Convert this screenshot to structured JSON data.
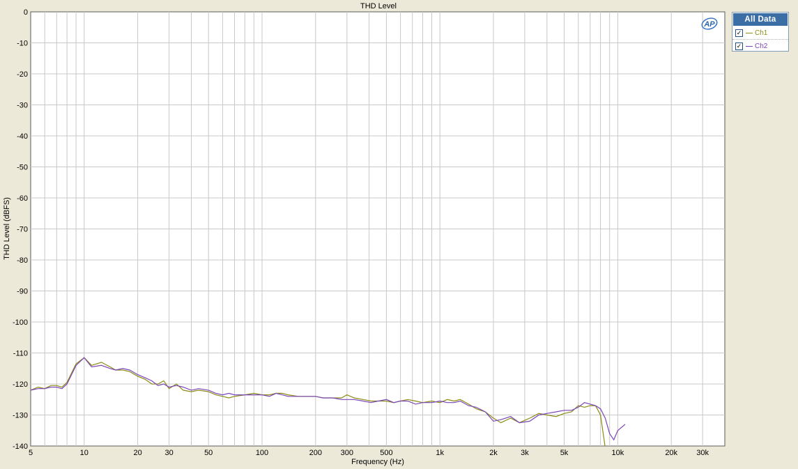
{
  "chart_data": {
    "type": "line",
    "title": "THD Level",
    "xlabel": "Frequency (Hz)",
    "ylabel": "THD Level (dBFS)",
    "x_scale": "log",
    "xlim": [
      5,
      40000
    ],
    "ylim": [
      -140,
      0
    ],
    "x_ticks": [
      5,
      10,
      20,
      30,
      50,
      100,
      200,
      300,
      500,
      1000,
      2000,
      3000,
      5000,
      10000,
      20000,
      30000
    ],
    "x_tick_labels": [
      "5",
      "10",
      "20",
      "30",
      "50",
      "100",
      "200",
      "300",
      "500",
      "1k",
      "2k",
      "3k",
      "5k",
      "10k",
      "20k",
      "30k"
    ],
    "y_ticks": [
      0,
      -10,
      -20,
      -30,
      -40,
      -50,
      -60,
      -70,
      -80,
      -90,
      -100,
      -110,
      -120,
      -130,
      -140
    ],
    "grid": true,
    "legend_placement": "right",
    "series": [
      {
        "name": "Ch1",
        "color": "#8b8b14",
        "points": [
          [
            5,
            -122
          ],
          [
            5.5,
            -121
          ],
          [
            6,
            -121.5
          ],
          [
            6.5,
            -120.5
          ],
          [
            7,
            -120.5
          ],
          [
            7.5,
            -121
          ],
          [
            8,
            -119.5
          ],
          [
            9,
            -113.5
          ],
          [
            10,
            -111.5
          ],
          [
            11,
            -114
          ],
          [
            12.5,
            -113
          ],
          [
            14,
            -114.5
          ],
          [
            15,
            -115.5
          ],
          [
            16.5,
            -115.5
          ],
          [
            18,
            -116
          ],
          [
            20,
            -117.5
          ],
          [
            22,
            -118.5
          ],
          [
            24,
            -120
          ],
          [
            26,
            -120
          ],
          [
            28,
            -119
          ],
          [
            30,
            -121.5
          ],
          [
            33,
            -120
          ],
          [
            36,
            -122
          ],
          [
            40,
            -122.5
          ],
          [
            44,
            -122
          ],
          [
            50,
            -122.5
          ],
          [
            55,
            -123.5
          ],
          [
            60,
            -124
          ],
          [
            65,
            -124.5
          ],
          [
            70,
            -124
          ],
          [
            80,
            -123.5
          ],
          [
            90,
            -123
          ],
          [
            100,
            -123.5
          ],
          [
            110,
            -123.5
          ],
          [
            120,
            -123
          ],
          [
            130,
            -123
          ],
          [
            140,
            -123.5
          ],
          [
            160,
            -124
          ],
          [
            180,
            -124
          ],
          [
            200,
            -124
          ],
          [
            220,
            -124.5
          ],
          [
            250,
            -124.5
          ],
          [
            280,
            -124.5
          ],
          [
            300,
            -123.5
          ],
          [
            330,
            -124.5
          ],
          [
            370,
            -125
          ],
          [
            410,
            -125.5
          ],
          [
            450,
            -125.5
          ],
          [
            500,
            -125.5
          ],
          [
            550,
            -126
          ],
          [
            600,
            -125.5
          ],
          [
            660,
            -125
          ],
          [
            730,
            -125.5
          ],
          [
            800,
            -126
          ],
          [
            900,
            -125.5
          ],
          [
            1000,
            -126
          ],
          [
            1100,
            -125
          ],
          [
            1200,
            -125.5
          ],
          [
            1300,
            -125
          ],
          [
            1450,
            -126.5
          ],
          [
            1600,
            -128
          ],
          [
            1800,
            -129
          ],
          [
            2000,
            -131
          ],
          [
            2200,
            -132.5
          ],
          [
            2500,
            -131
          ],
          [
            2800,
            -132.5
          ],
          [
            3200,
            -131
          ],
          [
            3600,
            -129.5
          ],
          [
            4000,
            -130
          ],
          [
            4500,
            -130.5
          ],
          [
            5000,
            -129.5
          ],
          [
            5500,
            -129
          ],
          [
            6000,
            -127
          ],
          [
            6500,
            -127.5
          ],
          [
            7000,
            -127
          ],
          [
            7500,
            -127
          ],
          [
            8000,
            -130
          ],
          [
            8500,
            -140.5
          ]
        ]
      },
      {
        "name": "Ch2",
        "color": "#7b46b8",
        "points": [
          [
            5,
            -122
          ],
          [
            5.5,
            -121.5
          ],
          [
            6,
            -121.5
          ],
          [
            6.5,
            -121
          ],
          [
            7,
            -121
          ],
          [
            7.5,
            -121.5
          ],
          [
            8,
            -120
          ],
          [
            9,
            -114
          ],
          [
            10,
            -111.5
          ],
          [
            11,
            -114.5
          ],
          [
            12.5,
            -114
          ],
          [
            14,
            -115
          ],
          [
            15,
            -115.5
          ],
          [
            16.5,
            -115
          ],
          [
            18,
            -115.5
          ],
          [
            20,
            -117
          ],
          [
            22,
            -118
          ],
          [
            24,
            -119
          ],
          [
            26,
            -120.5
          ],
          [
            28,
            -120
          ],
          [
            30,
            -121
          ],
          [
            33,
            -120.5
          ],
          [
            36,
            -121
          ],
          [
            40,
            -122
          ],
          [
            44,
            -121.5
          ],
          [
            50,
            -122
          ],
          [
            55,
            -123
          ],
          [
            60,
            -123.5
          ],
          [
            65,
            -123
          ],
          [
            70,
            -123.5
          ],
          [
            80,
            -123.5
          ],
          [
            90,
            -123.5
          ],
          [
            100,
            -123.5
          ],
          [
            110,
            -124
          ],
          [
            120,
            -123
          ],
          [
            130,
            -123.5
          ],
          [
            140,
            -124
          ],
          [
            160,
            -124
          ],
          [
            180,
            -124
          ],
          [
            200,
            -124
          ],
          [
            220,
            -124.5
          ],
          [
            250,
            -124.5
          ],
          [
            280,
            -125
          ],
          [
            300,
            -125
          ],
          [
            330,
            -125
          ],
          [
            370,
            -125.5
          ],
          [
            410,
            -126
          ],
          [
            450,
            -125.5
          ],
          [
            500,
            -125
          ],
          [
            550,
            -126
          ],
          [
            600,
            -125.5
          ],
          [
            660,
            -125.5
          ],
          [
            730,
            -126.5
          ],
          [
            800,
            -126
          ],
          [
            900,
            -126
          ],
          [
            1000,
            -125.5
          ],
          [
            1100,
            -126
          ],
          [
            1200,
            -126
          ],
          [
            1300,
            -125.5
          ],
          [
            1450,
            -127
          ],
          [
            1600,
            -127.5
          ],
          [
            1800,
            -129
          ],
          [
            2000,
            -132
          ],
          [
            2200,
            -131.5
          ],
          [
            2500,
            -130.5
          ],
          [
            2800,
            -132.5
          ],
          [
            3200,
            -132
          ],
          [
            3600,
            -130
          ],
          [
            4000,
            -129.5
          ],
          [
            4500,
            -129
          ],
          [
            5000,
            -128.5
          ],
          [
            5500,
            -128.5
          ],
          [
            6000,
            -127.5
          ],
          [
            6500,
            -126
          ],
          [
            7000,
            -126.5
          ],
          [
            7500,
            -127
          ],
          [
            8000,
            -128
          ],
          [
            8500,
            -131
          ],
          [
            9000,
            -136
          ],
          [
            9500,
            -138
          ],
          [
            10000,
            -135
          ],
          [
            11000,
            -133
          ]
        ]
      }
    ]
  },
  "legend": {
    "title": "All Data",
    "items": [
      {
        "label": "Ch1",
        "checked": "✓",
        "color": "#8b8b14"
      },
      {
        "label": "Ch2",
        "checked": "✓",
        "color": "#7b46b8"
      }
    ]
  },
  "logo": {
    "text": "AP",
    "icon": "ap-logo-icon"
  }
}
